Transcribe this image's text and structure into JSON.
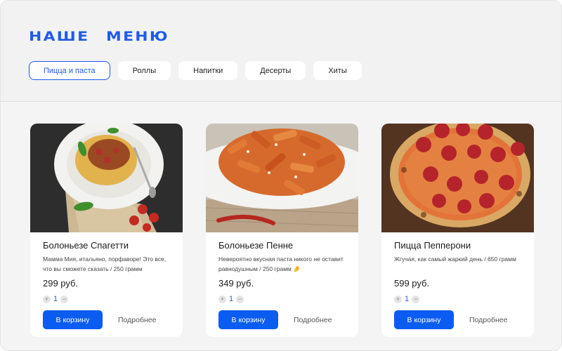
{
  "header": {
    "title": "НАШЕ МЕНЮ",
    "tabs": [
      {
        "label": "Пицца и паста",
        "active": true
      },
      {
        "label": "Роллы",
        "active": false
      },
      {
        "label": "Напитки",
        "active": false
      },
      {
        "label": "Десерты",
        "active": false
      },
      {
        "label": "Хиты",
        "active": false
      }
    ]
  },
  "products": [
    {
      "title": "Болоньезе Спагетти",
      "description": "Мамма Мия, итальяно, порфаворе! Это все, что вы сможете сказать / 250 грамм",
      "price": "299 руб.",
      "quantity": "1",
      "cart_label": "В корзину",
      "more_label": "Подробнее",
      "image": "spaghetti-bolognese-photo"
    },
    {
      "title": "Болоньезе Пенне",
      "description": "Невероятно вкусная паста никого не оставит равнодушным / 250 грамм 🤌",
      "price": "349 руб.",
      "quantity": "1",
      "cart_label": "В корзину",
      "more_label": "Подробнее",
      "image": "penne-bolognese-photo"
    },
    {
      "title": "Пицца Пепперони",
      "description": "Жгучая, как самый жаркий день / 650 грамм",
      "price": "599 руб.",
      "quantity": "1",
      "cart_label": "В корзину",
      "more_label": "Подробнее",
      "image": "pepperoni-pizza-photo"
    }
  ],
  "colors": {
    "accent": "#0b5cf0",
    "title": "#1f5be6",
    "background": "#f4f4f4"
  },
  "icons": {
    "plus": "plus-icon",
    "minus": "minus-icon"
  }
}
